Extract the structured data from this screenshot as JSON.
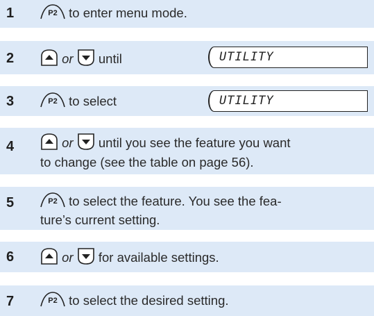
{
  "steps": [
    {
      "number": "1",
      "text": " to enter menu mode."
    },
    {
      "number": "2",
      "or": "or",
      "text": " until",
      "display": "UTILITY"
    },
    {
      "number": "3",
      "text": " to select",
      "display": "UTILITY"
    },
    {
      "number": "4",
      "or": "or",
      "text": " until you see the feature you want",
      "text2": "to change (see the table on page 56)."
    },
    {
      "number": "5",
      "text": " to select the feature. You see the fea-",
      "text2": "ture’s current setting."
    },
    {
      "number": "6",
      "or": "or",
      "text": " for available settings."
    },
    {
      "number": "7",
      "text": " to select the desired setting."
    }
  ],
  "button_labels": {
    "p2": "P2"
  },
  "icons": {
    "p2": "p2-button-icon",
    "up": "up-arrow-button-icon",
    "down": "down-arrow-button-icon"
  },
  "colors": {
    "band": "#dde9f7",
    "text": "#2a2a2a"
  }
}
